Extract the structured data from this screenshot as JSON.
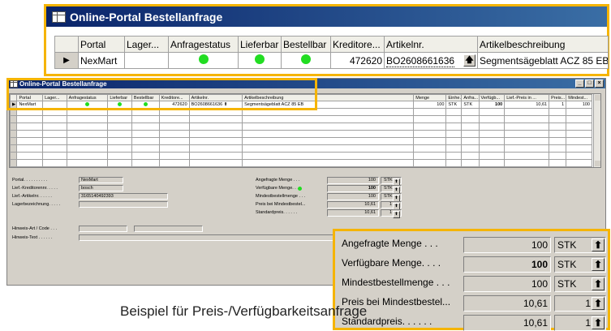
{
  "callout_top": {
    "title": "Online-Portal Bestellanfrage",
    "headers": [
      "Portal",
      "Lager...",
      "Anfragestatus",
      "Lieferbar",
      "Bestellbar",
      "Kreditore...",
      "Artikelnr.",
      "Artikelbeschreibung"
    ],
    "row": {
      "portal": "NexMart",
      "lager": "",
      "kreditor": "472620",
      "artikelnr": "BO2608661636",
      "beschreibung": "Segmentsägeblatt ACZ 85 EB"
    }
  },
  "window": {
    "title": "Online-Portal Bestellanfrage",
    "controls": [
      "_",
      "□",
      "×"
    ],
    "headers": [
      "Portal",
      "Lager...",
      "Anfragestatus",
      "Lieferbar",
      "Bestellbar",
      "Kreditore...",
      "Artikelnr.",
      "Artikelbeschreibung",
      "Menge",
      "Einhe...",
      "Anfra...",
      "Verfügb...",
      "Lief.-Preis in ...",
      "Preis...",
      "Mindest..."
    ],
    "row": {
      "portal": "NexMart",
      "kreditor": "472620",
      "artikelnr": "BO2608661636",
      "beschreibung": "Segmentsägeblatt ACZ 85 EB",
      "menge": "100",
      "einheit": "STK",
      "anfra": "STK",
      "verfuegb": "100",
      "preis": "10,61",
      "preis2": "1",
      "mindest": "100"
    },
    "form": {
      "portal_label": "Portal. . . . . . . . . .",
      "portal_value": "NexMart",
      "kreditor_label": "Lief.-Kreditorennr. . . . .",
      "kreditor_value": "bosch",
      "artikel_label": "Lief.-Artikelnr. . . . . .",
      "artikel_value": "3165140492393",
      "lager_label": "Lagerbezeichnung. . . . .",
      "hinweis_art_label": "Hinweis-Art / Code . . .",
      "hinweis_text_label": "Hinweis-Text . . . . . ."
    },
    "mini": [
      {
        "label": "Angefragte Menge . . .",
        "value": "100",
        "unit": "STK"
      },
      {
        "label": "Verfügbare Menge. . . .",
        "value": "100",
        "unit": "STK",
        "status": true
      },
      {
        "label": "Mindestbestellmenge . . .",
        "value": "100",
        "unit": "STK"
      },
      {
        "label": "Preis bei Mindestbestel...",
        "value": "10,61",
        "unit": "1"
      },
      {
        "label": "Standardpreis. . . . . .",
        "value": "10,61",
        "unit": "1"
      }
    ]
  },
  "callout_bottom": [
    {
      "label": "Angefragte Menge . . .",
      "value": "100",
      "unit": "STK"
    },
    {
      "label": "Verfügbare Menge. . . .",
      "value": "100",
      "unit": "STK",
      "status": true
    },
    {
      "label": "Mindestbestellmenge . . .",
      "value": "100",
      "unit": "STK"
    },
    {
      "label": "Preis bei Mindestbestel...",
      "value": "10,61",
      "unit": "1"
    },
    {
      "label": "Standardpreis. . . . . .",
      "value": "10,61",
      "unit": "1"
    }
  ],
  "caption": "Beispiel für Preis-/Verfügbarkeitsanfrage",
  "colors": {
    "callout": "#f5b400",
    "status_green": "#22dd22",
    "titlebar": "#0a246a"
  }
}
